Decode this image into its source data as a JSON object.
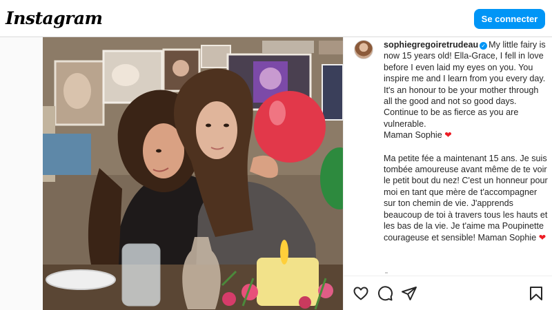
{
  "header": {
    "logo": "Instagram",
    "login_button": "Se connecter"
  },
  "post": {
    "username": "sophiegregoiretrudeau",
    "verified": true,
    "caption_en_text": "My little fairy is now 15 years old! Ella-Grace, I fell in love before I even laid my eyes on you. You inspire me and I learn from you every day. It's an honour to be your mother through all the good and not so good days. Continue to be as fierce as you are vulnerable.\nMaman Sophie",
    "caption_fr_text": "Ma petite fée a maintenant 15 ans. Je suis tombée amoureuse avant même de te voir le petit bout du nez! C'est un honneur pour moi en tant que mère de t'accompagner sur ton chemin de vie. J'apprends beaucoup de toi à travers tous les hauts et les bas de la vie. Je t'aime ma Poupinette courageuse et sensible! Maman Sophie",
    "heart_emoji": "❤"
  },
  "actions": {
    "like_icon": "heart-outline-icon",
    "comment_icon": "comment-icon",
    "share_icon": "paper-plane-icon",
    "save_icon": "bookmark-icon"
  },
  "colors": {
    "accent": "#0095f6",
    "heart": "#ed1c24"
  }
}
